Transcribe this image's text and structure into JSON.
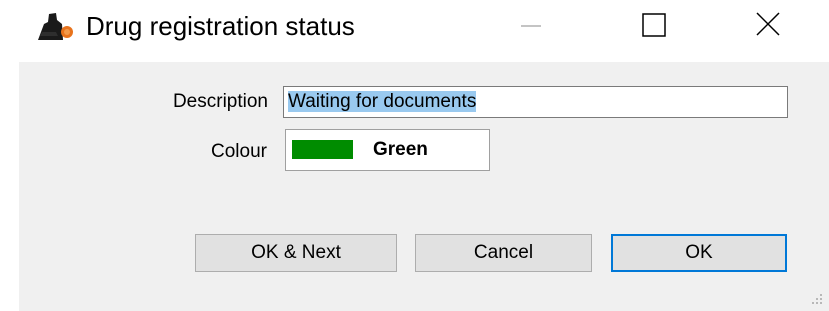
{
  "window": {
    "title": "Drug registration status",
    "controls": {
      "minimize": "minimize-icon",
      "maximize": "maximize-icon",
      "close": "close-icon"
    }
  },
  "form": {
    "description_label": "Description",
    "description_value": "Waiting for documents",
    "colour_label": "Colour",
    "colour_name": "Green",
    "colour_hex": "#008c00"
  },
  "buttons": {
    "ok_next": "OK & Next",
    "cancel": "Cancel",
    "ok": "OK"
  },
  "theme": {
    "selection": "#99c9ef",
    "default_button_border": "#0078d7"
  }
}
